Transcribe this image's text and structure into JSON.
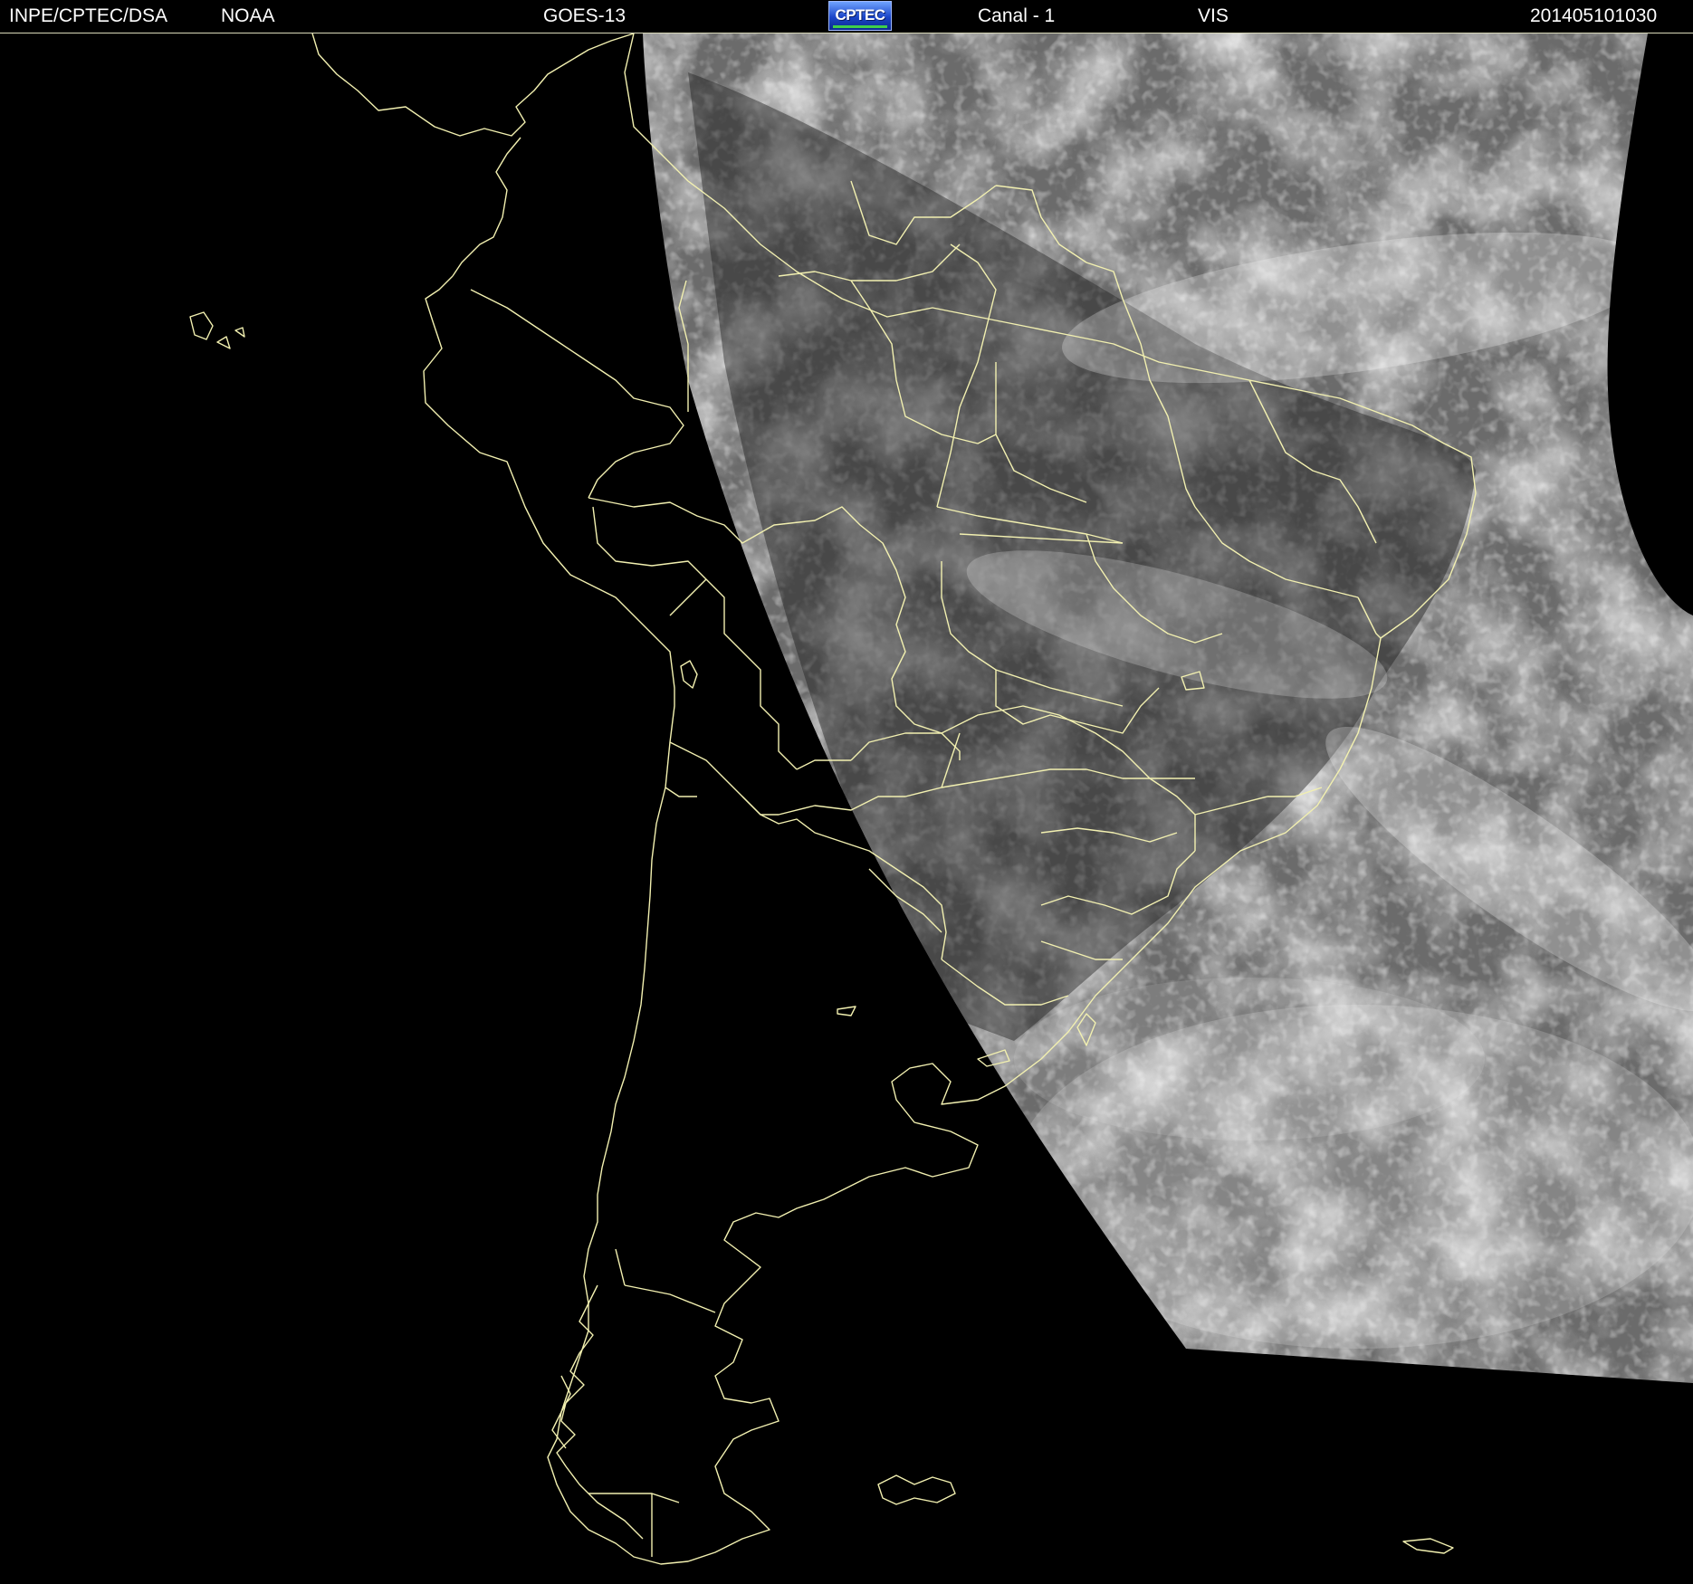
{
  "header": {
    "source": "INPE/CPTEC/DSA",
    "agency": "NOAA",
    "satellite": "GOES-13",
    "logo_text": "CPTEC",
    "channel": "Canal - 1",
    "band": "VIS",
    "timestamp": "201405101030"
  },
  "colors": {
    "background": "#000000",
    "header_text": "#ffffff",
    "border_lines": "#f2f0b0",
    "logo_blue": "#1a45c8"
  },
  "map": {
    "imagery": "satellite-visible-channel-grayscale",
    "overlay": "country-and-state-boundaries"
  }
}
